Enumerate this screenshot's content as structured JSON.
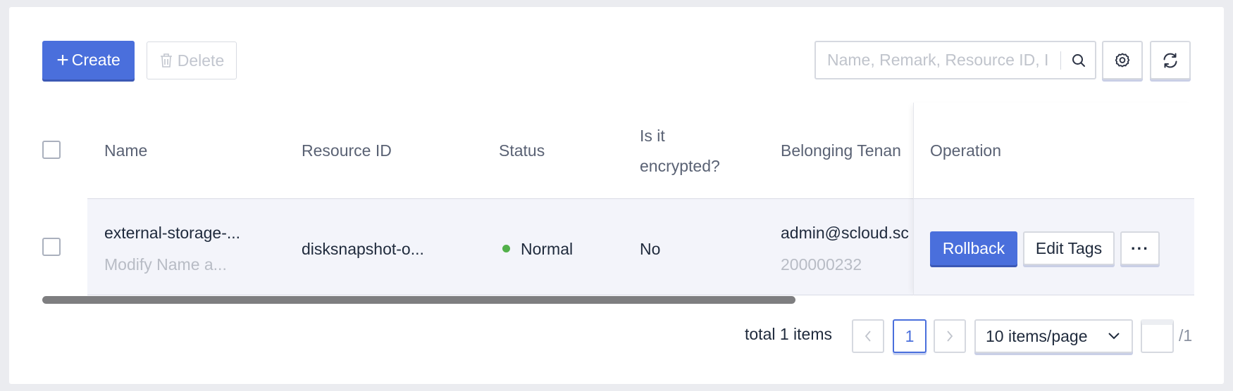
{
  "toolbar": {
    "create_label": "Create",
    "delete_label": "Delete",
    "search_placeholder": "Name, Remark, Resource ID, I"
  },
  "table": {
    "columns": {
      "name": "Name",
      "resource_id": "Resource ID",
      "status": "Status",
      "encrypted_line1": "Is it",
      "encrypted_line2": "encrypted?",
      "tenant": "Belonging Tenan",
      "operation": "Operation"
    },
    "rows": [
      {
        "name": "external-storage-...",
        "remark": "Modify Name a...",
        "resource_id": "disksnapshot-o...",
        "status": "Normal",
        "status_color": "#52b04a",
        "encrypted": "No",
        "tenant": "admin@scloud.sc",
        "tenant_id": "200000232",
        "actions": {
          "rollback": "Rollback",
          "edit_tags": "Edit Tags",
          "more": "···"
        }
      }
    ]
  },
  "pagination": {
    "total_text": "total 1 items",
    "current_page": "1",
    "page_size_label": "10 items/page",
    "jump_value": "",
    "total_pages_text": "/1"
  },
  "colors": {
    "primary": "#4a6fdc",
    "status_normal": "#52b04a"
  }
}
